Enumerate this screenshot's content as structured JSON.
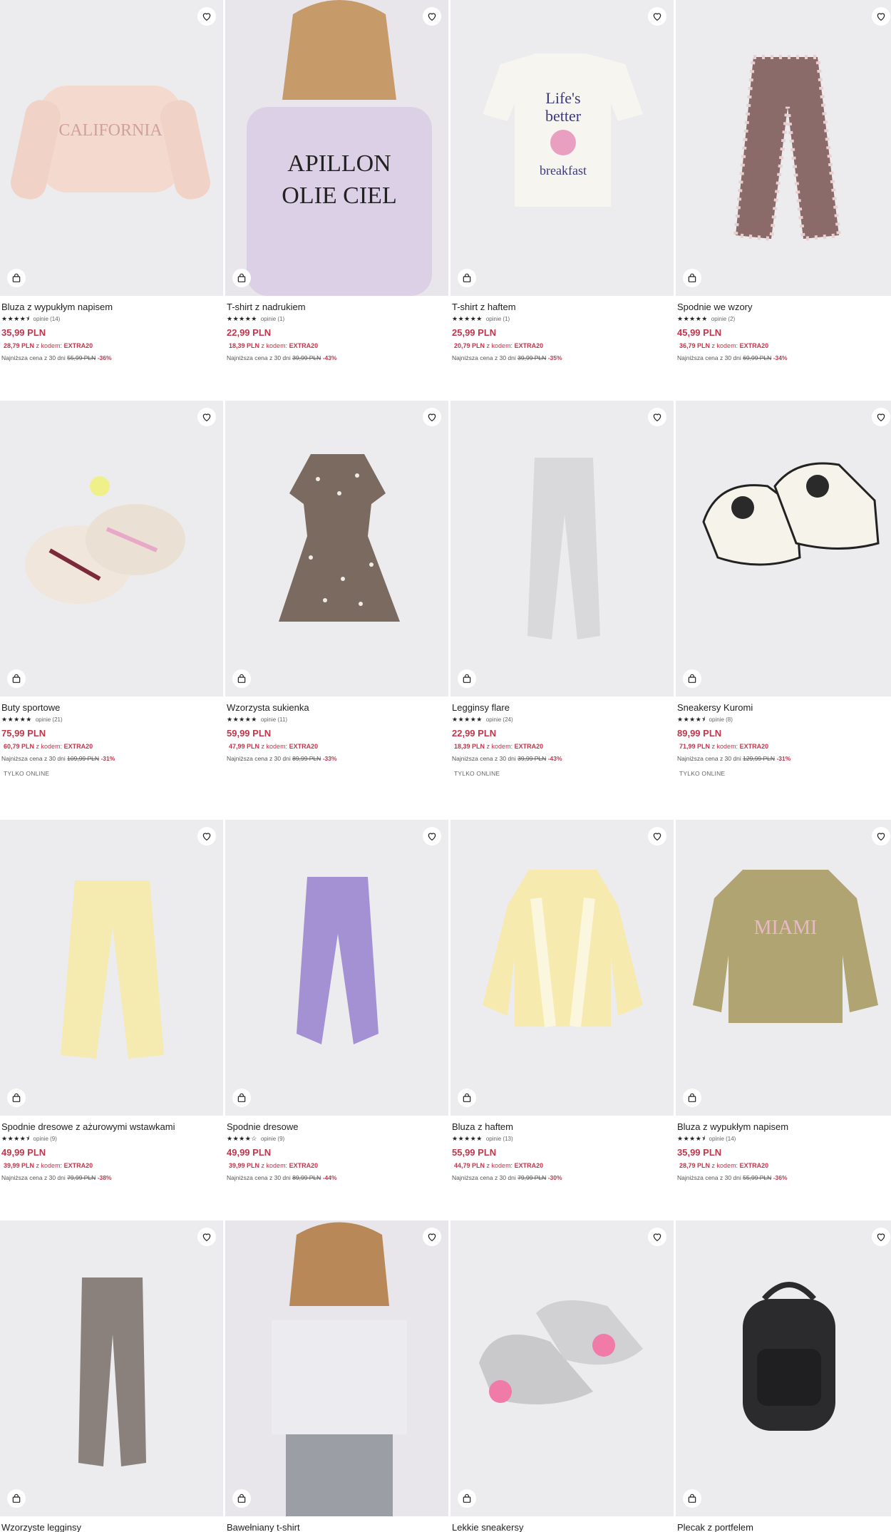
{
  "labels": {
    "reviews_prefix": "opinie",
    "promo_text": "z kodem:",
    "lowest_prefix": "Najniższa cena z 30 dni",
    "online_only": "TYLKO ONLINE"
  },
  "colors": {
    "accent": "#c0364b",
    "photo_bg": "#ececee"
  },
  "icons": {
    "favorite": "heart-icon",
    "add_to_cart": "shopping-bag-icon"
  },
  "products": [
    {
      "name": "Bluza z wypukłym napisem",
      "stars": "★★★★⯨",
      "reviews": "opinie (14)",
      "price": "35,99 PLN",
      "promo_price": "28,79 PLN",
      "code": "EXTRA20",
      "old_price": "55,99 PLN",
      "discount": "-36%",
      "online": ""
    },
    {
      "name": "T-shirt z nadrukiem",
      "stars": "★★★★★",
      "reviews": "opinie (1)",
      "price": "22,99 PLN",
      "promo_price": "18,39 PLN",
      "code": "EXTRA20",
      "old_price": "39,99 PLN",
      "discount": "-43%",
      "online": ""
    },
    {
      "name": "T-shirt z haftem",
      "stars": "★★★★★",
      "reviews": "opinie (1)",
      "price": "25,99 PLN",
      "promo_price": "20,79 PLN",
      "code": "EXTRA20",
      "old_price": "39,99 PLN",
      "discount": "-35%",
      "online": ""
    },
    {
      "name": "Spodnie we wzory",
      "stars": "★★★★★",
      "reviews": "opinie (2)",
      "price": "45,99 PLN",
      "promo_price": "36,79 PLN",
      "code": "EXTRA20",
      "old_price": "69,99 PLN",
      "discount": "-34%",
      "online": ""
    },
    {
      "name": "Buty sportowe",
      "stars": "★★★★★",
      "reviews": "opinie (21)",
      "price": "75,99 PLN",
      "promo_price": "60,79 PLN",
      "code": "EXTRA20",
      "old_price": "109,99 PLN",
      "discount": "-31%",
      "online": "TYLKO ONLINE"
    },
    {
      "name": "Wzorzysta sukienka",
      "stars": "★★★★★",
      "reviews": "opinie (11)",
      "price": "59,99 PLN",
      "promo_price": "47,99 PLN",
      "code": "EXTRA20",
      "old_price": "89,99 PLN",
      "discount": "-33%",
      "online": ""
    },
    {
      "name": "Legginsy flare",
      "stars": "★★★★★",
      "reviews": "opinie (24)",
      "price": "22,99 PLN",
      "promo_price": "18,39 PLN",
      "code": "EXTRA20",
      "old_price": "39,99 PLN",
      "discount": "-43%",
      "online": "TYLKO ONLINE"
    },
    {
      "name": "Sneakersy Kuromi",
      "stars": "★★★★⯨",
      "reviews": "opinie (8)",
      "price": "89,99 PLN",
      "promo_price": "71,99 PLN",
      "code": "EXTRA20",
      "old_price": "129,99 PLN",
      "discount": "-31%",
      "online": "TYLKO ONLINE"
    },
    {
      "name": "Spodnie dresowe z ażurowymi wstawkami",
      "stars": "★★★★⯨",
      "reviews": "opinie (9)",
      "price": "49,99 PLN",
      "promo_price": "39,99 PLN",
      "code": "EXTRA20",
      "old_price": "79,99 PLN",
      "discount": "-38%",
      "online": ""
    },
    {
      "name": "Spodnie dresowe",
      "stars": "★★★★☆",
      "reviews": "opinie (9)",
      "price": "49,99 PLN",
      "promo_price": "39,99 PLN",
      "code": "EXTRA20",
      "old_price": "89,99 PLN",
      "discount": "-44%",
      "online": ""
    },
    {
      "name": "Bluza z haftem",
      "stars": "★★★★★",
      "reviews": "opinie (13)",
      "price": "55,99 PLN",
      "promo_price": "44,79 PLN",
      "code": "EXTRA20",
      "old_price": "79,99 PLN",
      "discount": "-30%",
      "online": ""
    },
    {
      "name": "Bluza z wypukłym napisem",
      "stars": "★★★★⯨",
      "reviews": "opinie (14)",
      "price": "35,99 PLN",
      "promo_price": "28,79 PLN",
      "code": "EXTRA20",
      "old_price": "55,99 PLN",
      "discount": "-36%",
      "online": ""
    },
    {
      "name": "Wzorzyste legginsy",
      "stars": "",
      "reviews": "",
      "price": "",
      "promo_price": "",
      "code": "",
      "old_price": "",
      "discount": "",
      "online": ""
    },
    {
      "name": "Bawełniany t-shirt",
      "stars": "",
      "reviews": "",
      "price": "",
      "promo_price": "",
      "code": "",
      "old_price": "",
      "discount": "",
      "online": ""
    },
    {
      "name": "Lekkie sneakersy",
      "stars": "",
      "reviews": "",
      "price": "",
      "promo_price": "",
      "code": "",
      "old_price": "",
      "discount": "",
      "online": ""
    },
    {
      "name": "Plecak z portfelem",
      "stars": "",
      "reviews": "",
      "price": "",
      "promo_price": "",
      "code": "",
      "old_price": "",
      "discount": "",
      "online": ""
    }
  ]
}
